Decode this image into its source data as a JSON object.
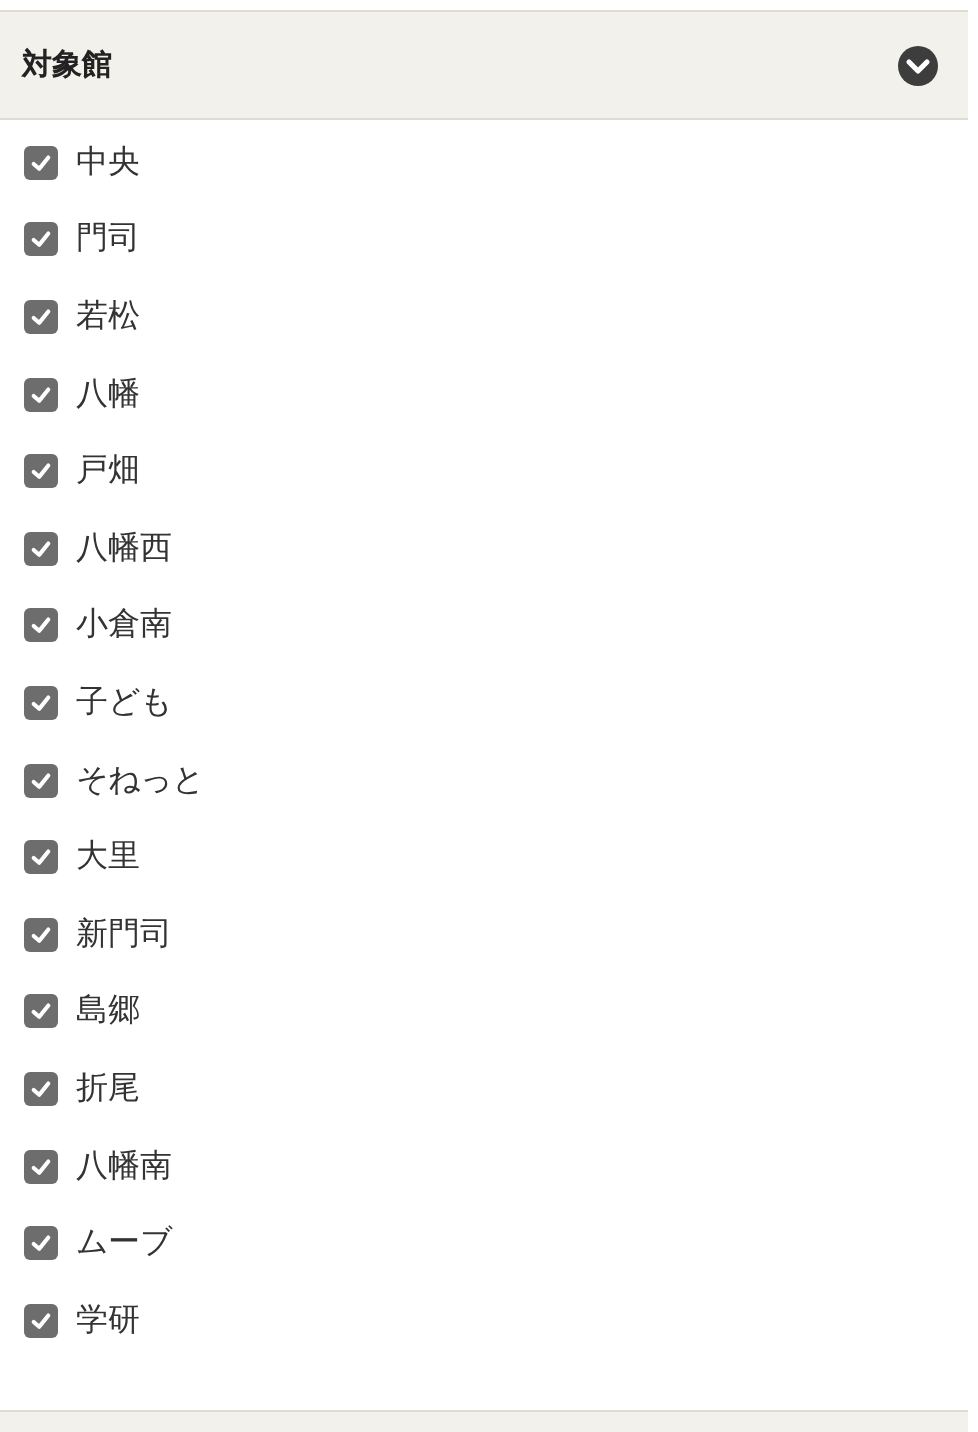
{
  "panel": {
    "title": "対象館",
    "items": [
      {
        "label": "中央",
        "checked": true
      },
      {
        "label": "門司",
        "checked": true
      },
      {
        "label": "若松",
        "checked": true
      },
      {
        "label": "八幡",
        "checked": true
      },
      {
        "label": "戸畑",
        "checked": true
      },
      {
        "label": "八幡西",
        "checked": true
      },
      {
        "label": "小倉南",
        "checked": true
      },
      {
        "label": "子ども",
        "checked": true
      },
      {
        "label": "そねっと",
        "checked": true
      },
      {
        "label": "大里",
        "checked": true
      },
      {
        "label": "新門司",
        "checked": true
      },
      {
        "label": "島郷",
        "checked": true
      },
      {
        "label": "折尾",
        "checked": true
      },
      {
        "label": "八幡南",
        "checked": true
      },
      {
        "label": "ムーブ",
        "checked": true
      },
      {
        "label": "学研",
        "checked": true
      }
    ]
  }
}
